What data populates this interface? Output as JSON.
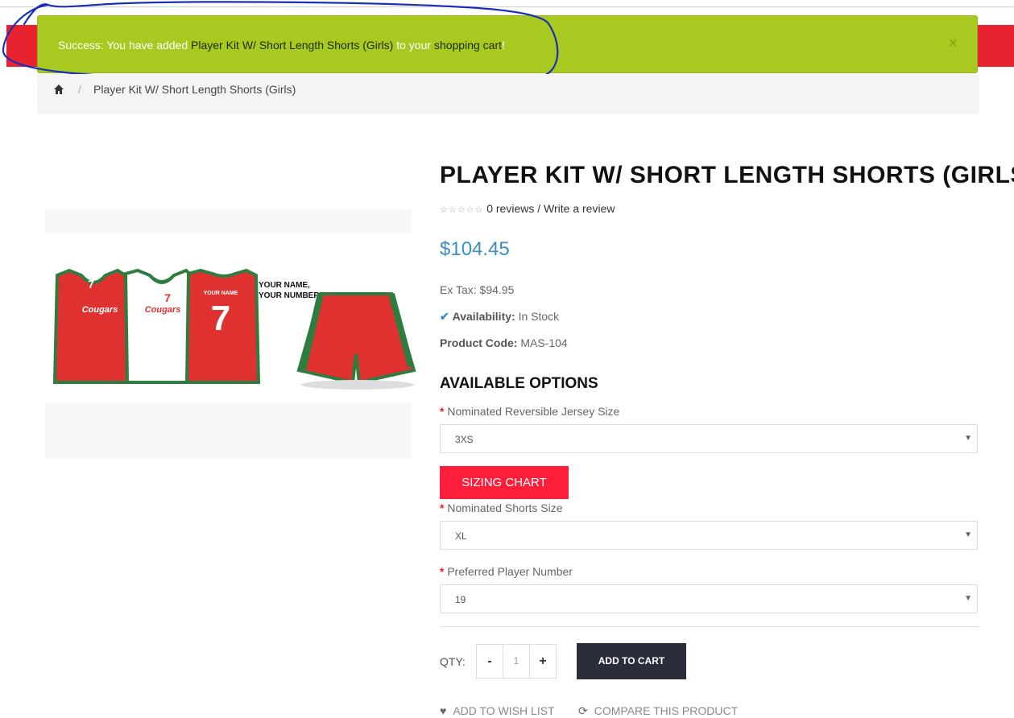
{
  "alert": {
    "prefix": "Success: You have added ",
    "product_link": "Player Kit W/ Short Length Shorts (Girls)",
    "middle": " to your ",
    "cart_link": "shopping cart",
    "suffix": "!",
    "close": "×"
  },
  "breadcrumb": {
    "separator": "/",
    "item": "Player Kit W/ Short Length Shorts (Girls)"
  },
  "image": {
    "text_name_top": "YOUR NAME",
    "text_number": "7",
    "text_team": "Cougars",
    "text_callout_1": "YOUR NAME,",
    "text_callout_2": "YOUR NUMBER*"
  },
  "product": {
    "title": "PLAYER KIT W/ SHORT LENGTH SHORTS (GIRLS)",
    "stars": "☆☆☆☆☆",
    "reviews": "0 reviews",
    "rating_sep": " / ",
    "write_review": "Write a review",
    "price": "$104.45",
    "ex_tax_label": "Ex Tax:",
    "ex_tax_value": "$94.95",
    "availability_label": "Availability:",
    "availability_value": "In Stock",
    "code_label": "Product Code:",
    "code_value": "MAS-104"
  },
  "options": {
    "title": "AVAILABLE OPTIONS",
    "required_mark": "*",
    "jersey_label": "Nominated Reversible Jersey Size",
    "jersey_value": "3XS",
    "sizing_chart": "SIZING CHART",
    "shorts_label": "Nominated Shorts Size",
    "shorts_value": "XL",
    "number_label": "Preferred Player Number",
    "number_value": "19",
    "arrow": "▼"
  },
  "purchase": {
    "qty_label": "QTY:",
    "minus": "-",
    "qty_value": "1",
    "plus": "+",
    "add_to_cart": "ADD TO CART",
    "wishlist": "ADD TO WISH LIST",
    "compare": "COMPARE THIS PRODUCT"
  },
  "colors": {
    "accent_red": "#e8232f",
    "alert_green": "#a8c91f",
    "price_blue": "#3b8fc4",
    "kit_green": "#2e7d3f"
  }
}
